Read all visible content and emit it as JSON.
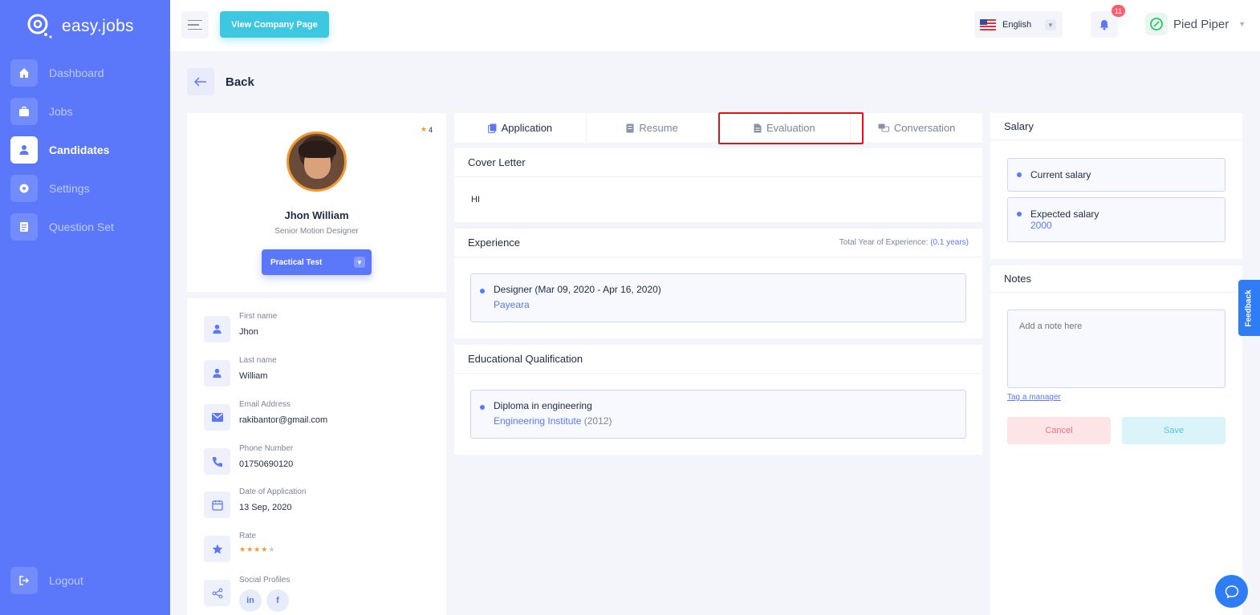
{
  "app": {
    "name": "easy.jobs"
  },
  "sidebar": {
    "items": [
      {
        "label": "Dashboard",
        "icon": "home-icon"
      },
      {
        "label": "Jobs",
        "icon": "briefcase-icon"
      },
      {
        "label": "Candidates",
        "icon": "user-icon",
        "active": true
      },
      {
        "label": "Settings",
        "icon": "gear-icon"
      },
      {
        "label": "Question Set",
        "icon": "document-icon"
      }
    ],
    "logout_label": "Logout"
  },
  "header": {
    "view_company_label": "View Company Page",
    "language": "English",
    "notification_count": "11",
    "company_name": "Pied Piper"
  },
  "back_label": "Back",
  "profile": {
    "rating_badge": "4",
    "name": "Jhon William",
    "role": "Senior Motion Designer",
    "stage": "Practical Test"
  },
  "details": {
    "first_name_label": "First name",
    "first_name": "Jhon",
    "last_name_label": "Last name",
    "last_name": "William",
    "email_label": "Email Address",
    "email": "rakibantor@gmail.com",
    "phone_label": "Phone Number",
    "phone": "01750690120",
    "date_label": "Date of Application",
    "date": "13 Sep, 2020",
    "rate_label": "Rate",
    "rate_value": 4,
    "rate_max": 5,
    "social_label": "Social Profiles",
    "social": [
      "in",
      "f"
    ]
  },
  "tabs": [
    {
      "label": "Application",
      "icon": "application-icon",
      "active": true
    },
    {
      "label": "Resume",
      "icon": "resume-icon"
    },
    {
      "label": "Evaluation",
      "icon": "evaluation-icon"
    },
    {
      "label": "Conversation",
      "icon": "conversation-icon"
    }
  ],
  "cover_letter": {
    "title": "Cover Letter",
    "text": "HI"
  },
  "experience": {
    "title": "Experience",
    "total_label": "Total Year of Experience:",
    "total_value": "(0.1 years)",
    "entries": [
      {
        "title": "Designer (Mar 09, 2020 - Apr 16, 2020)",
        "company": "Payeara"
      }
    ]
  },
  "education": {
    "title": "Educational Qualification",
    "entries": [
      {
        "title": "Diploma in engineering",
        "institute": "Engineering Institute",
        "year": "(2012)"
      }
    ]
  },
  "salary": {
    "title": "Salary",
    "current_label": "Current salary",
    "expected_label": "Expected salary",
    "expected_value": "2000"
  },
  "notes": {
    "title": "Notes",
    "placeholder": "Add a note here",
    "tag_label": "Tag a manager",
    "cancel_label": "Cancel",
    "save_label": "Save"
  },
  "feedback_label": "Feedback",
  "colors": {
    "primary": "#5b78fb",
    "accent": "#3ec7e0",
    "star": "#f5962f"
  }
}
